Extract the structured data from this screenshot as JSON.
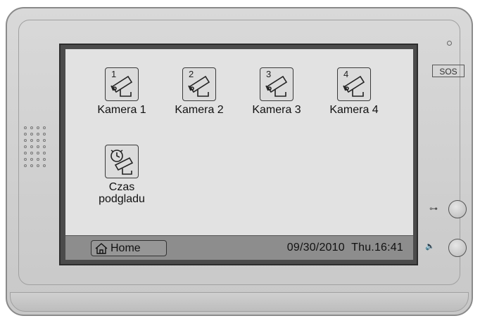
{
  "sos_label": "SOS",
  "tiles": [
    {
      "number": "1",
      "label": "Kamera 1"
    },
    {
      "number": "2",
      "label": "Kamera 2"
    },
    {
      "number": "3",
      "label": "Kamera 3"
    },
    {
      "number": "4",
      "label": "Kamera 4"
    }
  ],
  "timer_tile": {
    "label_line1": "Czas",
    "label_line2": "podgladu"
  },
  "statusbar": {
    "home_label": "Home",
    "date": "09/30/2010",
    "time": "Thu.16:41"
  },
  "side_glyphs": {
    "unlock": "⊶",
    "talk": "🔈"
  },
  "icons": [
    "camera-icon",
    "alarm-clock-icon",
    "home-icon",
    "key-icon",
    "speaker-icon"
  ]
}
